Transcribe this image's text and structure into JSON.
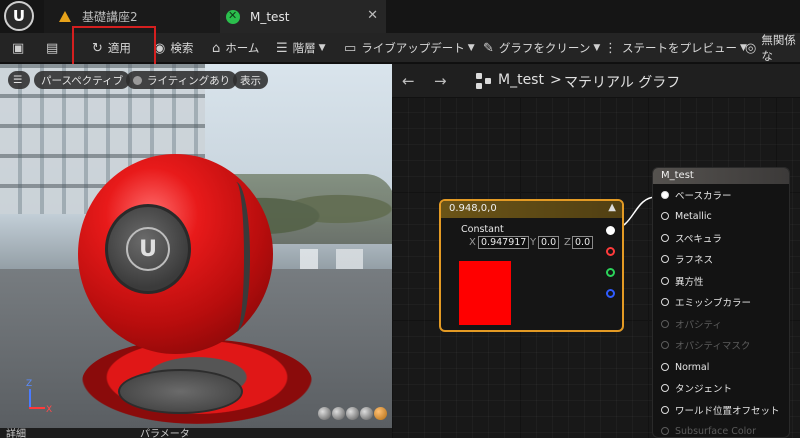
{
  "tabs": {
    "tab1_label": "基礎講座2",
    "tab2_label": "M_test",
    "close_glyph": "✕"
  },
  "toolbar": {
    "apply": "適用",
    "search": "検索",
    "home": "ホーム",
    "hierarchy": "階層",
    "live_update": "ライブアップデート",
    "clean_graph": "グラフをクリーン",
    "preview_state": "ステートをプレビュー",
    "hide_unrelated": "無関係な"
  },
  "viewport": {
    "perspective": "パースペクティブ",
    "lighting": "ライティングあり",
    "show": "表示",
    "logo_text": "UNREAL ENGINE",
    "axis_z": "Z",
    "axis_x": "X"
  },
  "bottom_tabs": {
    "details": "詳細",
    "parameters": "パラメータ"
  },
  "graph": {
    "breadcrumb_material": "M_test",
    "breadcrumb_sep": ">",
    "breadcrumb_graph": "マテリアル グラフ"
  },
  "constant_node": {
    "title": "0.948,0,0",
    "label": "Constant",
    "x_label": "X",
    "x_value": "0.947917",
    "y_label": "Y",
    "y_value": "0.0",
    "z_label": "Z",
    "z_value": "0.0",
    "swatch_color": "#ff0000"
  },
  "material_node": {
    "title": "M_test",
    "pins": [
      "ベースカラー",
      "Metallic",
      "スペキュラ",
      "ラフネス",
      "異方性",
      "エミッシブカラー",
      "オパシティ",
      "オパシティマスク",
      "Normal",
      "タンジェント",
      "ワールド位置オフセット",
      "Subsurface Color"
    ]
  },
  "colors": {
    "accent_orange": "#e39a24",
    "highlight_red": "#d41f1f",
    "material_green": "#2bbf4d"
  }
}
